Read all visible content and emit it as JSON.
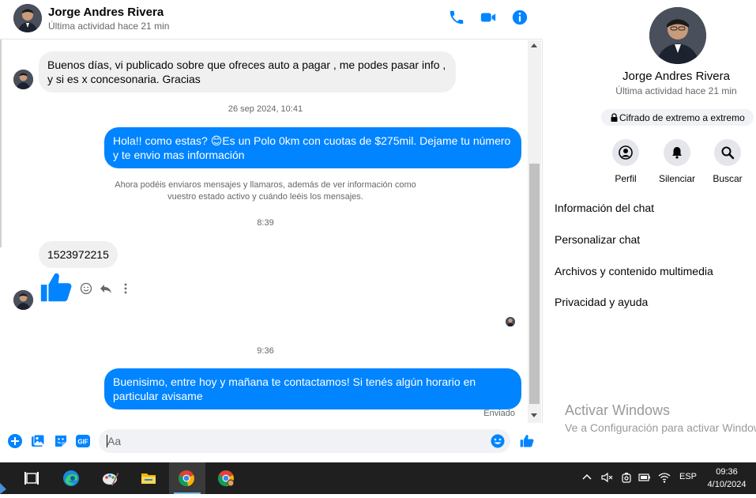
{
  "contact": {
    "name": "Jorge Andres Rivera",
    "status": "Última actividad hace 21 min"
  },
  "header": {
    "icons": [
      "phone-icon",
      "video-camera-icon",
      "info-icon"
    ]
  },
  "messages": {
    "msg1": "Buenos días, vi publicado sobre que ofreces auto a pagar , me podes pasar info , y si es x concesonaria. Gracias",
    "ts1": "26 sep 2024, 10:41",
    "msg2_before": "Hola!! como estas? ",
    "msg2_emoji": "😊",
    "msg2_after": "Es un Polo 0km con cuotas de $275mil. Dejame tu número y te envio mas información",
    "notice_line1": "Ahora podéis enviaros mensajes y llamaros, además de ver información como",
    "notice_line2": "vuestro estado activo y cuándo leéis los mensajes.",
    "ts2": "8:39",
    "msg3": "1523972215",
    "ts3": "9:36",
    "msg4": "Buenisimo, entre hoy y mañana te contactamos! Si tenés algún horario en particular avisame",
    "sent_label": "Enviado"
  },
  "composer": {
    "placeholder": "Aa",
    "icons": [
      "plus-icon",
      "image-icon",
      "sticker-icon",
      "gif-icon",
      "emoji-icon",
      "thumbs-up-icon"
    ],
    "gif_label": "GIF"
  },
  "panel": {
    "name": "Jorge Andres Rivera",
    "status": "Última actividad hace 21 min",
    "encryption": "Cifrado de extremo a extremo",
    "actions": [
      {
        "label": "Perfil",
        "icon": "profile-icon"
      },
      {
        "label": "Silenciar",
        "icon": "bell-icon"
      },
      {
        "label": "Buscar",
        "icon": "search-icon"
      }
    ],
    "items": [
      "Información del chat",
      "Personalizar chat",
      "Archivos y contenido multimedia",
      "Privacidad y ayuda"
    ]
  },
  "watermark": {
    "title": "Activar Windows",
    "subtitle": "Ve a Configuración para activar Windows."
  },
  "taskbar": {
    "apps": [
      "task-view-icon",
      "edge-icon",
      "paint-icon",
      "file-explorer-icon",
      "chrome-icon",
      "chrome-profile-icon"
    ],
    "language": "ESP",
    "time": "09:36",
    "date": "4/10/2024"
  },
  "colors": {
    "accent": "#0084ff",
    "incoming_bubble": "#f0f0f0",
    "taskbar": "#1f1f1f"
  }
}
